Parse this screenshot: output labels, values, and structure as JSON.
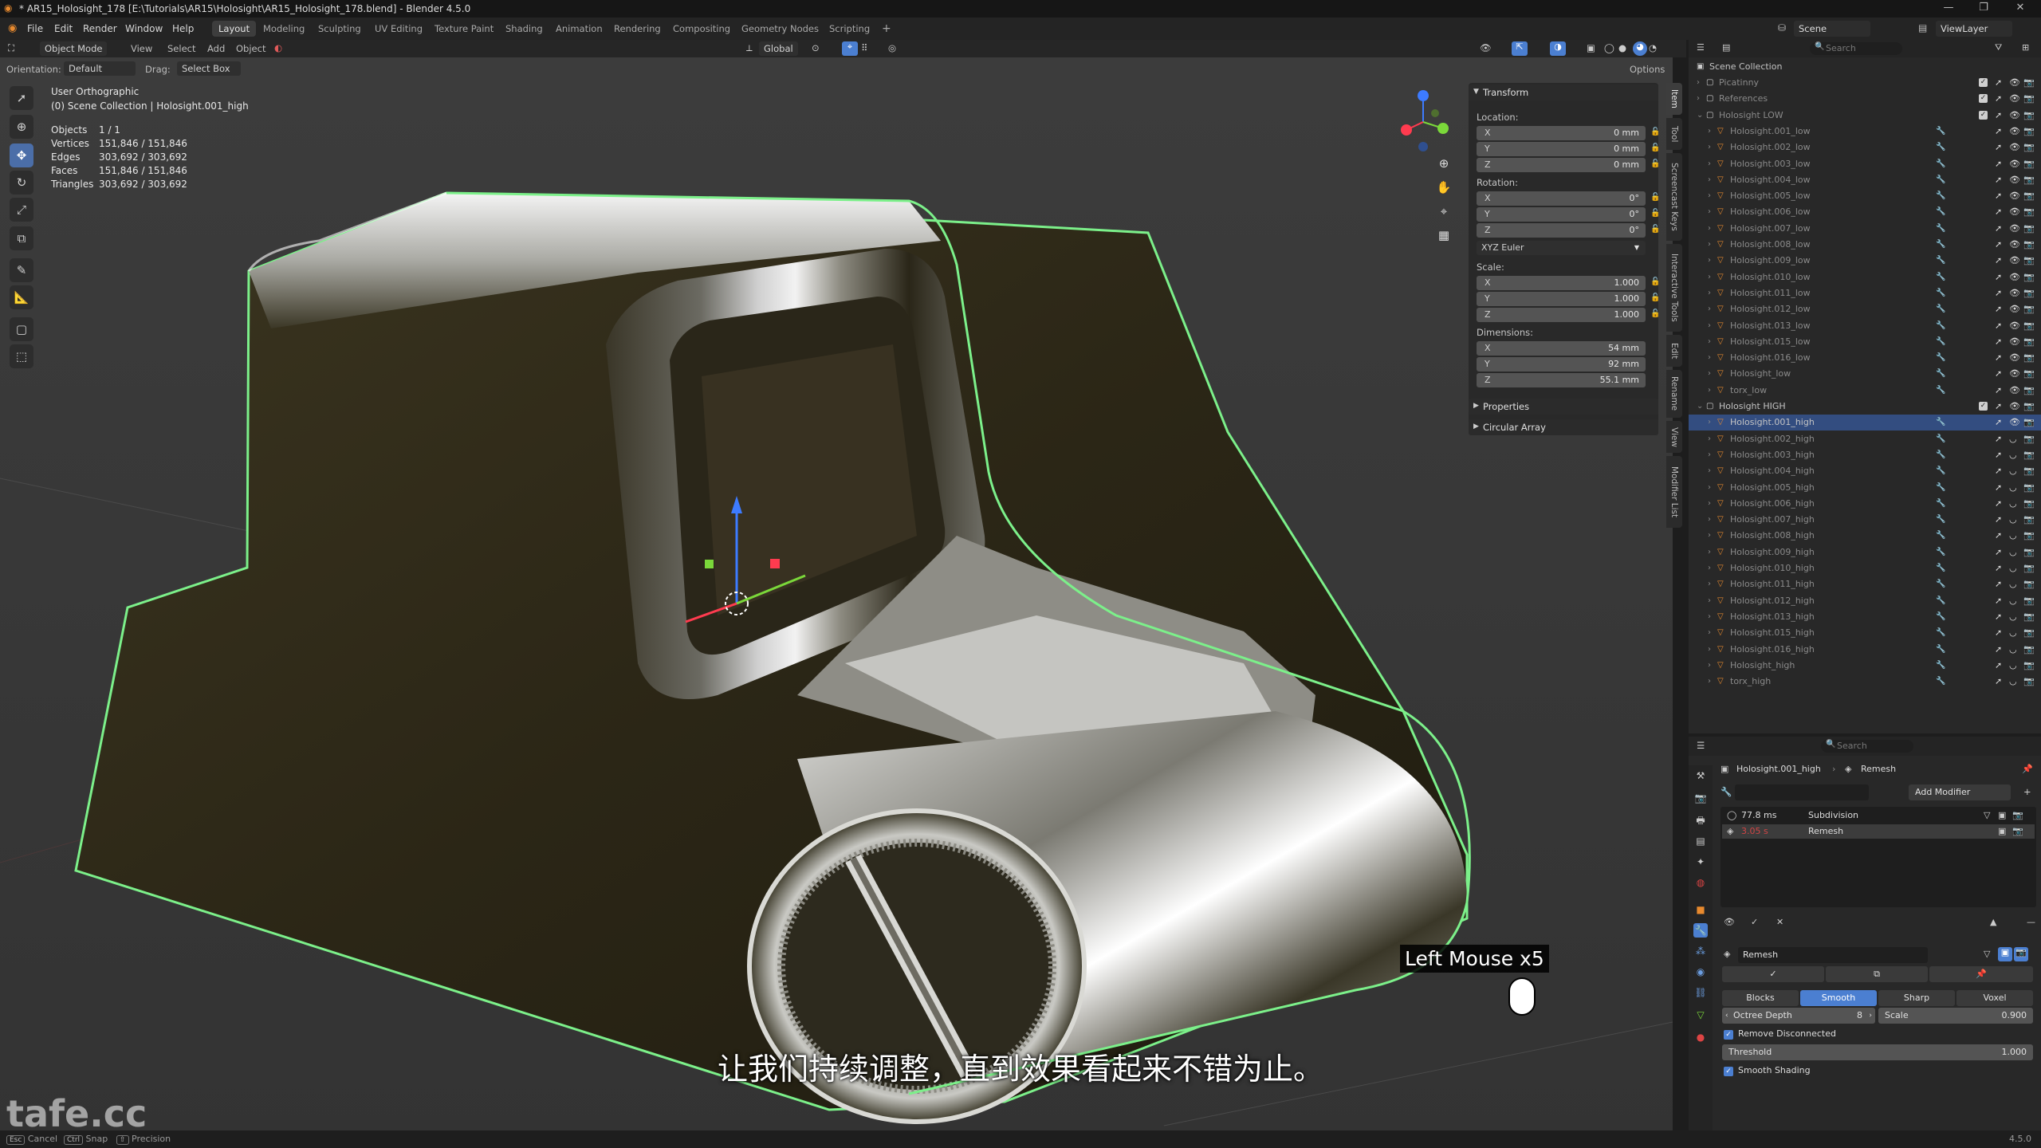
{
  "window": {
    "title": "* AR15_Holosight_178 [E:\\Tutorials\\AR15\\Holosight\\AR15_Holosight_178.blend] - Blender 4.5.0"
  },
  "menu": [
    "File",
    "Edit",
    "Render",
    "Window",
    "Help"
  ],
  "workspaces": [
    "Layout",
    "Modeling",
    "Sculpting",
    "UV Editing",
    "Texture Paint",
    "Shading",
    "Animation",
    "Rendering",
    "Compositing",
    "Geometry Nodes",
    "Scripting"
  ],
  "scene": {
    "name": "Scene",
    "viewlayer": "ViewLayer"
  },
  "header": {
    "mode": "Object Mode",
    "menus": [
      "View",
      "Select",
      "Add",
      "Object"
    ],
    "orientation_label": "Orientation:",
    "orientation_value": "Default",
    "drag_label": "Drag:",
    "drag_value": "Select Box",
    "transform_orientation": "Global",
    "options": "Options"
  },
  "viewport": {
    "view_name": "User Orthographic",
    "collection_path": "(0) Scene Collection | Holosight.001_high",
    "stats": [
      {
        "label": "Objects",
        "value": "1 / 1"
      },
      {
        "label": "Vertices",
        "value": "151,846 / 151,846"
      },
      {
        "label": "Edges",
        "value": "303,692 / 303,692"
      },
      {
        "label": "Faces",
        "value": "151,846 / 151,846"
      },
      {
        "label": "Triangles",
        "value": "303,692 / 303,692"
      }
    ],
    "subtitle": "让我们持续调整，直到效果看起来不错为止。",
    "keycast": "Left Mouse x5",
    "watermark": "tafe.cc"
  },
  "npanel": {
    "transform_title": "Transform",
    "location_label": "Location:",
    "location": [
      {
        "axis": "X",
        "value": "0 mm"
      },
      {
        "axis": "Y",
        "value": "0 mm"
      },
      {
        "axis": "Z",
        "value": "0 mm"
      }
    ],
    "rotation_label": "Rotation:",
    "rotation": [
      {
        "axis": "X",
        "value": "0°"
      },
      {
        "axis": "Y",
        "value": "0°"
      },
      {
        "axis": "Z",
        "value": "0°"
      }
    ],
    "rotation_mode": "XYZ Euler",
    "scale_label": "Scale:",
    "scale": [
      {
        "axis": "X",
        "value": "1.000"
      },
      {
        "axis": "Y",
        "value": "1.000"
      },
      {
        "axis": "Z",
        "value": "1.000"
      }
    ],
    "dimensions_label": "Dimensions:",
    "dimensions": [
      {
        "axis": "X",
        "value": "54 mm"
      },
      {
        "axis": "Y",
        "value": "92 mm"
      },
      {
        "axis": "Z",
        "value": "55.1 mm"
      }
    ],
    "properties_title": "Properties",
    "circular_array_title": "Circular Array",
    "tabs": [
      "Item",
      "Tool",
      "Screencast Keys",
      "Interactive Tools",
      "Edit",
      "Rename",
      "View",
      "Modifier List"
    ]
  },
  "outliner": {
    "search_placeholder": "Search",
    "root": "Scene Collection",
    "items": [
      {
        "name": "Picatinny",
        "level": 1,
        "kind": "collection",
        "dim": true
      },
      {
        "name": "References",
        "level": 1,
        "kind": "collection",
        "dim": true
      },
      {
        "name": "Holosight LOW",
        "level": 1,
        "kind": "collection",
        "dim": true
      },
      {
        "name": "Holosight.001_low",
        "level": 2,
        "kind": "mesh",
        "dim": true
      },
      {
        "name": "Holosight.002_low",
        "level": 2,
        "kind": "mesh",
        "dim": true
      },
      {
        "name": "Holosight.003_low",
        "level": 2,
        "kind": "mesh",
        "dim": true
      },
      {
        "name": "Holosight.004_low",
        "level": 2,
        "kind": "mesh",
        "dim": true
      },
      {
        "name": "Holosight.005_low",
        "level": 2,
        "kind": "mesh",
        "dim": true
      },
      {
        "name": "Holosight.006_low",
        "level": 2,
        "kind": "mesh",
        "dim": true
      },
      {
        "name": "Holosight.007_low",
        "level": 2,
        "kind": "mesh",
        "dim": true
      },
      {
        "name": "Holosight.008_low",
        "level": 2,
        "kind": "mesh",
        "dim": true
      },
      {
        "name": "Holosight.009_low",
        "level": 2,
        "kind": "mesh",
        "dim": true
      },
      {
        "name": "Holosight.010_low",
        "level": 2,
        "kind": "mesh",
        "dim": true
      },
      {
        "name": "Holosight.011_low",
        "level": 2,
        "kind": "mesh",
        "dim": true
      },
      {
        "name": "Holosight.012_low",
        "level": 2,
        "kind": "mesh",
        "dim": true
      },
      {
        "name": "Holosight.013_low",
        "level": 2,
        "kind": "mesh",
        "dim": true
      },
      {
        "name": "Holosight.015_low",
        "level": 2,
        "kind": "mesh",
        "dim": true
      },
      {
        "name": "Holosight.016_low",
        "level": 2,
        "kind": "mesh",
        "dim": true
      },
      {
        "name": "Holosight_low",
        "level": 2,
        "kind": "mesh",
        "dim": true
      },
      {
        "name": "torx_low",
        "level": 2,
        "kind": "mesh",
        "dim": true
      },
      {
        "name": "Holosight HIGH",
        "level": 1,
        "kind": "collection",
        "dim": false
      },
      {
        "name": "Holosight.001_high",
        "level": 2,
        "kind": "mesh",
        "dim": false,
        "selected": true
      },
      {
        "name": "Holosight.002_high",
        "level": 2,
        "kind": "mesh",
        "dim": true
      },
      {
        "name": "Holosight.003_high",
        "level": 2,
        "kind": "mesh",
        "dim": true
      },
      {
        "name": "Holosight.004_high",
        "level": 2,
        "kind": "mesh",
        "dim": true
      },
      {
        "name": "Holosight.005_high",
        "level": 2,
        "kind": "mesh",
        "dim": true
      },
      {
        "name": "Holosight.006_high",
        "level": 2,
        "kind": "mesh",
        "dim": true
      },
      {
        "name": "Holosight.007_high",
        "level": 2,
        "kind": "mesh",
        "dim": true
      },
      {
        "name": "Holosight.008_high",
        "level": 2,
        "kind": "mesh",
        "dim": true
      },
      {
        "name": "Holosight.009_high",
        "level": 2,
        "kind": "mesh",
        "dim": true
      },
      {
        "name": "Holosight.010_high",
        "level": 2,
        "kind": "mesh",
        "dim": true
      },
      {
        "name": "Holosight.011_high",
        "level": 2,
        "kind": "mesh",
        "dim": true
      },
      {
        "name": "Holosight.012_high",
        "level": 2,
        "kind": "mesh",
        "dim": true
      },
      {
        "name": "Holosight.013_high",
        "level": 2,
        "kind": "mesh",
        "dim": true
      },
      {
        "name": "Holosight.015_high",
        "level": 2,
        "kind": "mesh",
        "dim": true
      },
      {
        "name": "Holosight.016_high",
        "level": 2,
        "kind": "mesh",
        "dim": true
      },
      {
        "name": "Holosight_high",
        "level": 2,
        "kind": "mesh",
        "dim": true
      },
      {
        "name": "torx_high",
        "level": 2,
        "kind": "mesh",
        "dim": true
      }
    ]
  },
  "properties": {
    "search_placeholder": "Search",
    "breadcrumb_object": "Holosight.001_high",
    "breadcrumb_modifier": "Remesh",
    "add_modifier": "Add Modifier",
    "modifiers": [
      {
        "time": "77.8 ms",
        "name": "Subdivision"
      },
      {
        "time": "3.05 s",
        "name": "Remesh"
      }
    ],
    "remesh_name": "Remesh",
    "modes": [
      "Blocks",
      "Smooth",
      "Sharp",
      "Voxel"
    ],
    "active_mode": "Smooth",
    "octree_depth_label": "Octree Depth",
    "octree_depth_value": "8",
    "scale_label": "Scale",
    "scale_value": "0.900",
    "remove_disconnected": "Remove Disconnected",
    "threshold_label": "Threshold",
    "threshold_value": "1.000",
    "smooth_shading": "Smooth Shading"
  },
  "statusbar": {
    "cancel": "Cancel",
    "snap": "Snap",
    "precision": "Precision",
    "version": "4.5.0"
  },
  "colors": {
    "accent": "#4b7fd1",
    "selection_outline": "#7cf08a",
    "outliner_selected": "#334d80",
    "error_time": "#d04545"
  }
}
